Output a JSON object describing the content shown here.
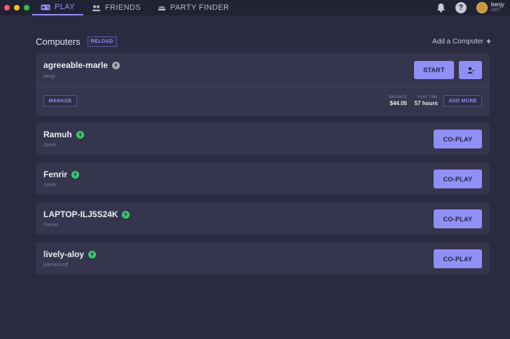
{
  "titlebar": {
    "tabs": [
      {
        "label": "PLAY",
        "icon": "gamepad-icon",
        "active": true
      },
      {
        "label": "FRIENDS",
        "icon": "friends-icon",
        "active": false
      },
      {
        "label": "PARTY FINDER",
        "icon": "party-icon",
        "active": false
      }
    ],
    "help_glyph": "?",
    "user": {
      "name": "benjy",
      "tag": "#377"
    }
  },
  "section": {
    "title": "Computers",
    "reload_label": "RELOAD",
    "add_label": "Add a Computer",
    "add_glyph": "+"
  },
  "own_computer": {
    "name": "agreeable-marle",
    "owner": "benjy",
    "start_label": "START",
    "manage_label": "MANAGE",
    "balance_label": "BALANCE",
    "balance_value": "$44.05",
    "playtime_label": "PLAY TIME",
    "playtime_value": "57 hours",
    "add_more_label": "ADD MORE"
  },
  "shared_computers": [
    {
      "name": "Ramuh",
      "owner": "Jamie",
      "action_label": "CO-PLAY"
    },
    {
      "name": "Fenrir",
      "owner": "Jamie",
      "action_label": "CO-PLAY"
    },
    {
      "name": "LAPTOP-ILJ5S24K",
      "owner": "Parsec",
      "action_label": "CO-PLAY"
    },
    {
      "name": "lively-aloy",
      "owner": "jakelazaroff",
      "action_label": "CO-PLAY"
    }
  ],
  "colors": {
    "accent": "#8f8ff5",
    "online": "#2fd06a",
    "background": "#2a2a40",
    "card": "#35354d"
  }
}
